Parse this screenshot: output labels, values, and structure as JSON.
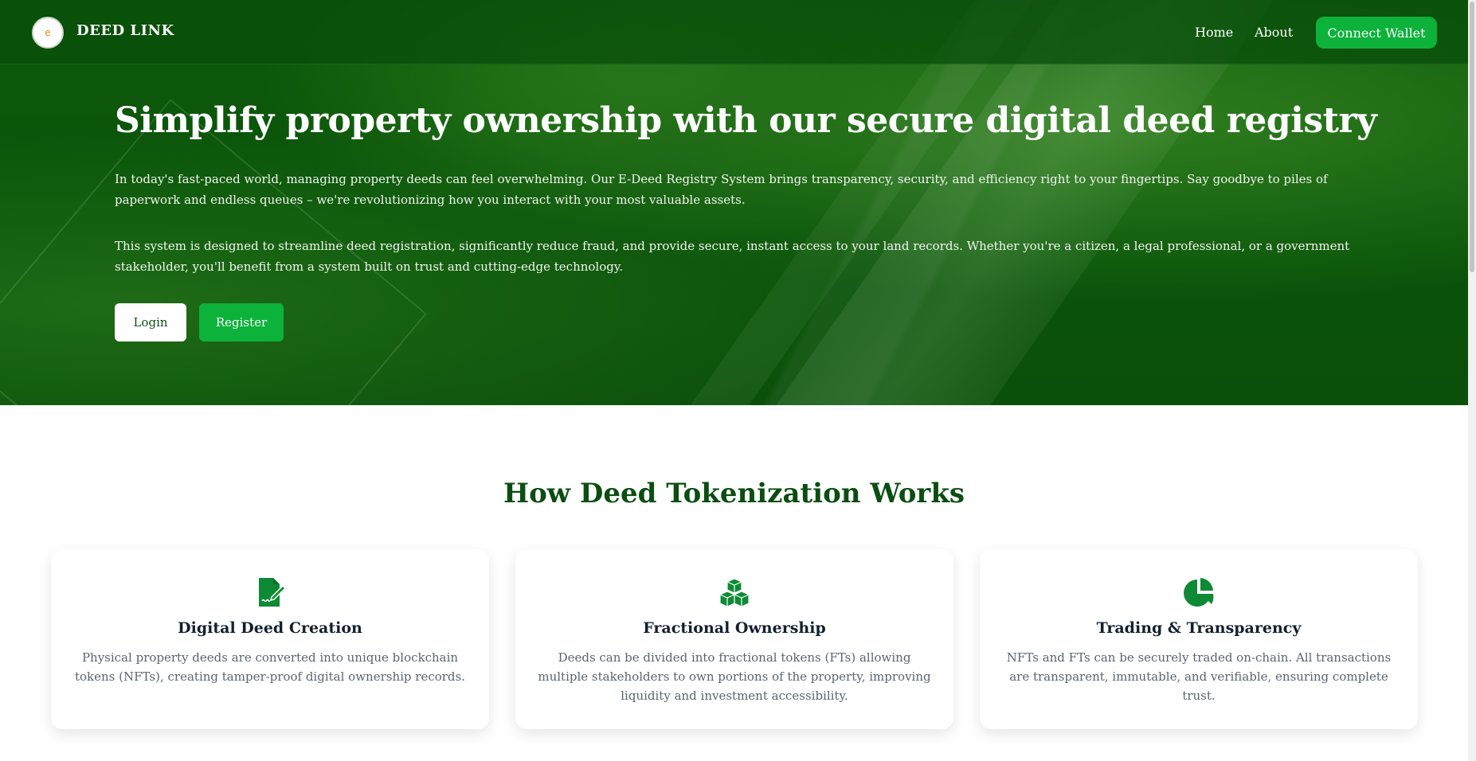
{
  "header": {
    "logo_text": "e",
    "brand": "DEED LINK",
    "nav": [
      {
        "label": "Home"
      },
      {
        "label": "About"
      }
    ],
    "connect_wallet": "Connect Wallet"
  },
  "hero": {
    "title": "Simplify property ownership with our secure digital deed registry",
    "paragraph1": "In today's fast-paced world, managing property deeds can feel overwhelming. Our E-Deed Registry System brings transparency, security, and efficiency right to your fingertips. Say goodbye to piles of paperwork and endless queues – we're revolutionizing how you interact with your most valuable assets.",
    "paragraph2": "This system is designed to streamline deed registration, significantly reduce fraud, and provide secure, instant access to your land records. Whether you're a citizen, a legal professional, or a government stakeholder, you'll benefit from a system built on trust and cutting-edge technology.",
    "login": "Login",
    "register": "Register"
  },
  "how": {
    "title": "How Deed Tokenization Works",
    "cards": [
      {
        "icon": "file-signature-icon",
        "title": "Digital Deed Creation",
        "desc": "Physical property deeds are converted into unique blockchain tokens (NFTs), creating tamper-proof digital ownership records."
      },
      {
        "icon": "cubes-icon",
        "title": "Fractional Ownership",
        "desc": "Deeds can be divided into fractional tokens (FTs) allowing multiple stakeholders to own portions of the property, improving liquidity and investment accessibility."
      },
      {
        "icon": "pie-chart-icon",
        "title": "Trading & Transparency",
        "desc": "NFTs and FTs can be securely traded on-chain. All transactions are transparent, immutable, and verifiable, ensuring complete trust."
      }
    ]
  },
  "colors": {
    "brand_green": "#0b4e12",
    "accent_green": "#0cb23a",
    "icon_green": "#0e8a34"
  }
}
